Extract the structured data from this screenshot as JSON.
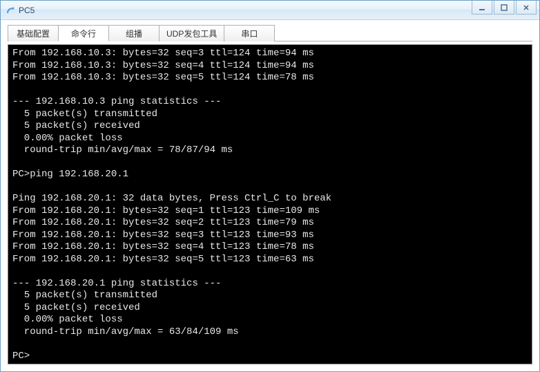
{
  "window": {
    "title": "PC5"
  },
  "tabs": [
    {
      "label": "基础配置"
    },
    {
      "label": "命令行"
    },
    {
      "label": "组播"
    },
    {
      "label": "UDP发包工具"
    },
    {
      "label": "串口"
    }
  ],
  "active_tab_index": 1,
  "terminal_lines": [
    "From 192.168.10.3: bytes=32 seq=3 ttl=124 time=94 ms",
    "From 192.168.10.3: bytes=32 seq=4 ttl=124 time=94 ms",
    "From 192.168.10.3: bytes=32 seq=5 ttl=124 time=78 ms",
    "",
    "--- 192.168.10.3 ping statistics ---",
    "  5 packet(s) transmitted",
    "  5 packet(s) received",
    "  0.00% packet loss",
    "  round-trip min/avg/max = 78/87/94 ms",
    "",
    "PC>ping 192.168.20.1",
    "",
    "Ping 192.168.20.1: 32 data bytes, Press Ctrl_C to break",
    "From 192.168.20.1: bytes=32 seq=1 ttl=123 time=109 ms",
    "From 192.168.20.1: bytes=32 seq=2 ttl=123 time=79 ms",
    "From 192.168.20.1: bytes=32 seq=3 ttl=123 time=93 ms",
    "From 192.168.20.1: bytes=32 seq=4 ttl=123 time=78 ms",
    "From 192.168.20.1: bytes=32 seq=5 ttl=123 time=63 ms",
    "",
    "--- 192.168.20.1 ping statistics ---",
    "  5 packet(s) transmitted",
    "  5 packet(s) received",
    "  0.00% packet loss",
    "  round-trip min/avg/max = 63/84/109 ms",
    "",
    "PC>"
  ]
}
